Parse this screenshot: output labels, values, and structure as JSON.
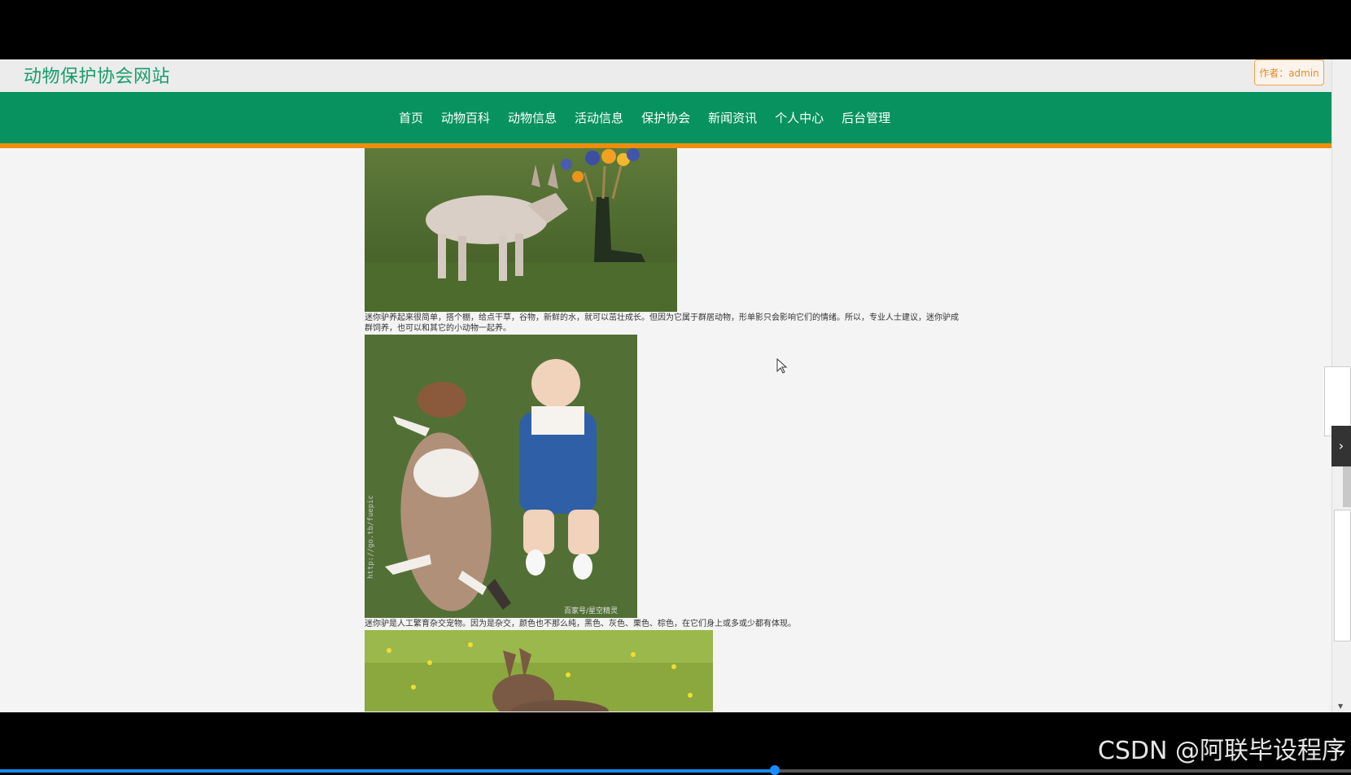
{
  "header": {
    "site_title": "动物保护协会网站",
    "author_badge": "作者：admin"
  },
  "nav": {
    "items": [
      "首页",
      "动物百科",
      "动物信息",
      "活动信息",
      "保护协会",
      "新闻资讯",
      "个人中心",
      "后台管理"
    ]
  },
  "article": {
    "caption_1": "迷你驴养起来很简单，搭个棚，给点干草，谷物，新鲜的水，就可以茁壮成长。但因为它属于群居动物，形单影只会影响它们的情绪。所以，专业人士建议，迷你驴成群饲养，也可以和其它的小动物一起养。",
    "caption_2": "迷你驴是人工繁育杂交宠物。因为是杂交，颜色也不那么纯，黑色、灰色、栗色、棕色，在它们身上或多或少都有体现。",
    "photo_2_watermark_side": "http://go.tb/fuepic",
    "photo_2_watermark_corner": "百家号/星空精灵"
  },
  "overlay": {
    "watermark": "CSDN @阿联毕设程序"
  },
  "colors": {
    "brand_green": "#07925f",
    "title_green": "#169d6b",
    "accent_orange": "#f08c0e"
  }
}
